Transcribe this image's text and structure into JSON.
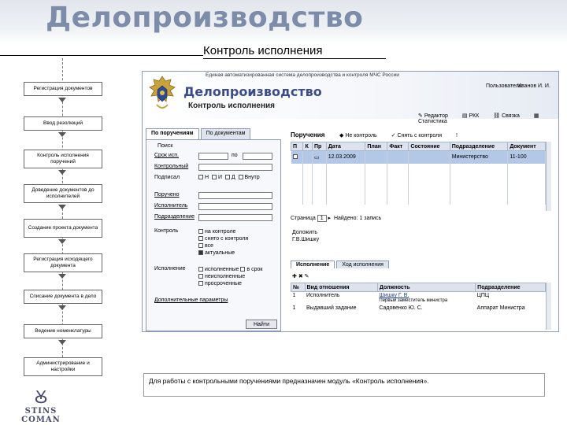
{
  "slide": {
    "title": "Делопроизводство",
    "subtitle": "Контроль исполнения"
  },
  "flow": [
    {
      "id": "registration",
      "label": "Регистрация документов"
    },
    {
      "id": "resolutions",
      "label": "Ввод резолюций"
    },
    {
      "id": "control",
      "label": "Контроль исполнения поручений"
    },
    {
      "id": "delivery",
      "label": "Доведение документов до исполнителей"
    },
    {
      "id": "draft",
      "label": "Создание проекта документа"
    },
    {
      "id": "outgoing",
      "label": "Регистрация исходящего документа"
    },
    {
      "id": "archive",
      "label": "Списание документа в дело"
    },
    {
      "id": "nomenclature",
      "label": "Ведение номенклатуры"
    },
    {
      "id": "admin",
      "label": "Администрирование и настройки"
    }
  ],
  "logo": {
    "mark": "Ꙋ",
    "text": "STINS COMAN"
  },
  "app": {
    "system_name": "Единая автоматизированная система делопроизводства и контроля МЧС России",
    "title": "Делопроизводство",
    "subtitle": "Контроль исполнения",
    "user_label": "Пользователь:",
    "user_name": "Иванов И. И.",
    "toolbar": [
      "Редактор",
      "РКК",
      "Связка",
      "Статистика"
    ],
    "tabs": [
      "По поручениям",
      "По документам"
    ],
    "search": {
      "group": "Поиск",
      "date_label": "Срок исп.",
      "date_sep": "по",
      "check_label": "Контрольный",
      "checks1": [
        "Н",
        "И",
        "Д",
        "Внутр"
      ],
      "sign_label": "Подписал",
      "ordered_label": "Поручено",
      "executor_label": "Исполнитель",
      "unit_label": "Подразделение",
      "control_label": "Контроль",
      "control_options": [
        {
          "label": "на контроле",
          "checked": false
        },
        {
          "label": "снято с контроля",
          "checked": false
        },
        {
          "label": "все",
          "checked": false
        },
        {
          "label": "актуальные",
          "checked": true
        }
      ],
      "exec_label": "Исполнение",
      "exec_options": [
        {
          "label": "исполненные",
          "checked": false
        },
        {
          "label": "в срок",
          "checked": false
        },
        {
          "label": "неисполненные",
          "checked": false
        },
        {
          "label": "просроченные",
          "checked": false
        }
      ],
      "extra_label": "Дополнительные параметры",
      "find_button": "Найти"
    },
    "orders": {
      "title": "Поручения",
      "actions": [
        "Не контроль",
        "Снять с контроля"
      ],
      "columns": [
        "П",
        "К",
        "Пр",
        "Дата",
        "План",
        "Факт",
        "Состояние",
        "Подразделение",
        "Документ"
      ],
      "rows": [
        {
          "date": "12.03.2009",
          "plan": "",
          "fact": "",
          "state": "",
          "unit": "Министерство",
          "doc": "11-100"
        }
      ],
      "pager_label": "Страница",
      "pager_page": "1",
      "pager_total": "Найдено: 1 запись",
      "order_title": "Доложить",
      "order_person": "Г.В.Шишку"
    },
    "detail_tabs": [
      "Исполнение",
      "Ход исполнения"
    ],
    "detail": {
      "columns": [
        "№",
        "Вид отношения",
        "Должность",
        "Подразделение"
      ],
      "rows": [
        {
          "n": "1",
          "kind": "Исполнитель",
          "person": "Шишку Г. В.",
          "position": "Первый заместитель министра",
          "unit": "ЦПЦ"
        },
        {
          "n": "1",
          "kind": "Выдавший задание",
          "person": "Садовенко Ю. С.",
          "position": "",
          "unit": "Аппарат Министра"
        }
      ]
    }
  },
  "caption": "Для работы с контрольными поручениями предназначен модуль «Контроль исполнения».",
  "colors": {
    "title": "#7d8ca8",
    "app_title": "#3c4c8a",
    "selected_row": "#b3c7e6",
    "header_bg": "#dde3ee"
  }
}
